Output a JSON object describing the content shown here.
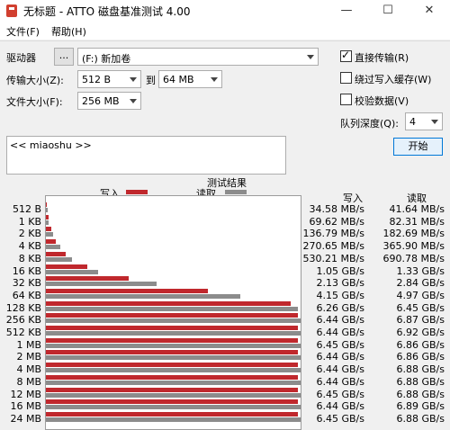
{
  "window": {
    "title": "无标题 - ATTO 磁盘基准测试 4.00",
    "minimize": "—",
    "maximize": "☐",
    "close": "✕"
  },
  "menu": [
    "文件(F)",
    "帮助(H)"
  ],
  "settings": {
    "drive_label": "驱动器",
    "browse_label": "...",
    "drive_value": "(F:) 新加卷",
    "transfer_label": "传输大小(Z):",
    "transfer_from": "512 B",
    "to_label": "到",
    "transfer_to": "64 MB",
    "file_label": "文件大小(F):",
    "file_value": "256 MB",
    "direct_io_label": "直接传输(R)",
    "direct_io_checked": true,
    "bypass_cache_label": "绕过写入缓存(W)",
    "bypass_cache_checked": false,
    "verify_label": "校验数据(V)",
    "verify_checked": false,
    "queue_label": "队列深度(Q):",
    "queue_value": "4",
    "start_label": "开始"
  },
  "description": "<< miaoshu >>",
  "results": {
    "title": "测试结果",
    "legend_write": "写入",
    "legend_read": "读取",
    "col_write": "写入",
    "col_read": "读取"
  },
  "chart_data": {
    "type": "bar",
    "orientation": "horizontal",
    "title": "测试结果",
    "categories": [
      "512 B",
      "1 KB",
      "2 KB",
      "4 KB",
      "8 KB",
      "16 KB",
      "32 KB",
      "64 KB",
      "128 KB",
      "256 KB",
      "512 KB",
      "1 MB",
      "2 MB",
      "4 MB",
      "8 MB",
      "12 MB",
      "16 MB",
      "24 MB"
    ],
    "x_max_bytes_per_sec": 7000000000,
    "series": [
      {
        "name": "写入",
        "color": "#c0282d",
        "values_mb_s": [
          34.58,
          69.62,
          136.79,
          270.65,
          530.21,
          1075.2,
          2181.12,
          4249.6,
          6410.24,
          6594.56,
          6594.56,
          6604.8,
          6594.56,
          6594.56,
          6594.56,
          6604.8,
          6594.56,
          6604.8
        ],
        "labels": [
          "34.58 MB/s",
          "69.62 MB/s",
          "136.79 MB/s",
          "270.65 MB/s",
          "530.21 MB/s",
          "1.05 GB/s",
          "2.13 GB/s",
          "4.15 GB/s",
          "6.26 GB/s",
          "6.44 GB/s",
          "6.44 GB/s",
          "6.45 GB/s",
          "6.44 GB/s",
          "6.44 GB/s",
          "6.44 GB/s",
          "6.45 GB/s",
          "6.44 GB/s",
          "6.45 GB/s"
        ]
      },
      {
        "name": "读取",
        "color": "#8c8c8c",
        "values_mb_s": [
          41.64,
          82.31,
          182.69,
          365.9,
          690.78,
          1361.92,
          2908.16,
          5089.28,
          6604.8,
          7034.88,
          7086.08,
          7024.64,
          7024.64,
          7045.12,
          7045.12,
          7045.12,
          7055.36,
          7045.12
        ],
        "labels": [
          "41.64 MB/s",
          "82.31 MB/s",
          "182.69 MB/s",
          "365.90 MB/s",
          "690.78 MB/s",
          "1.33 GB/s",
          "2.84 GB/s",
          "4.97 GB/s",
          "6.45 GB/s",
          "6.87 GB/s",
          "6.92 GB/s",
          "6.86 GB/s",
          "6.86 GB/s",
          "6.88 GB/s",
          "6.88 GB/s",
          "6.88 GB/s",
          "6.89 GB/s",
          "6.88 GB/s"
        ]
      }
    ]
  }
}
